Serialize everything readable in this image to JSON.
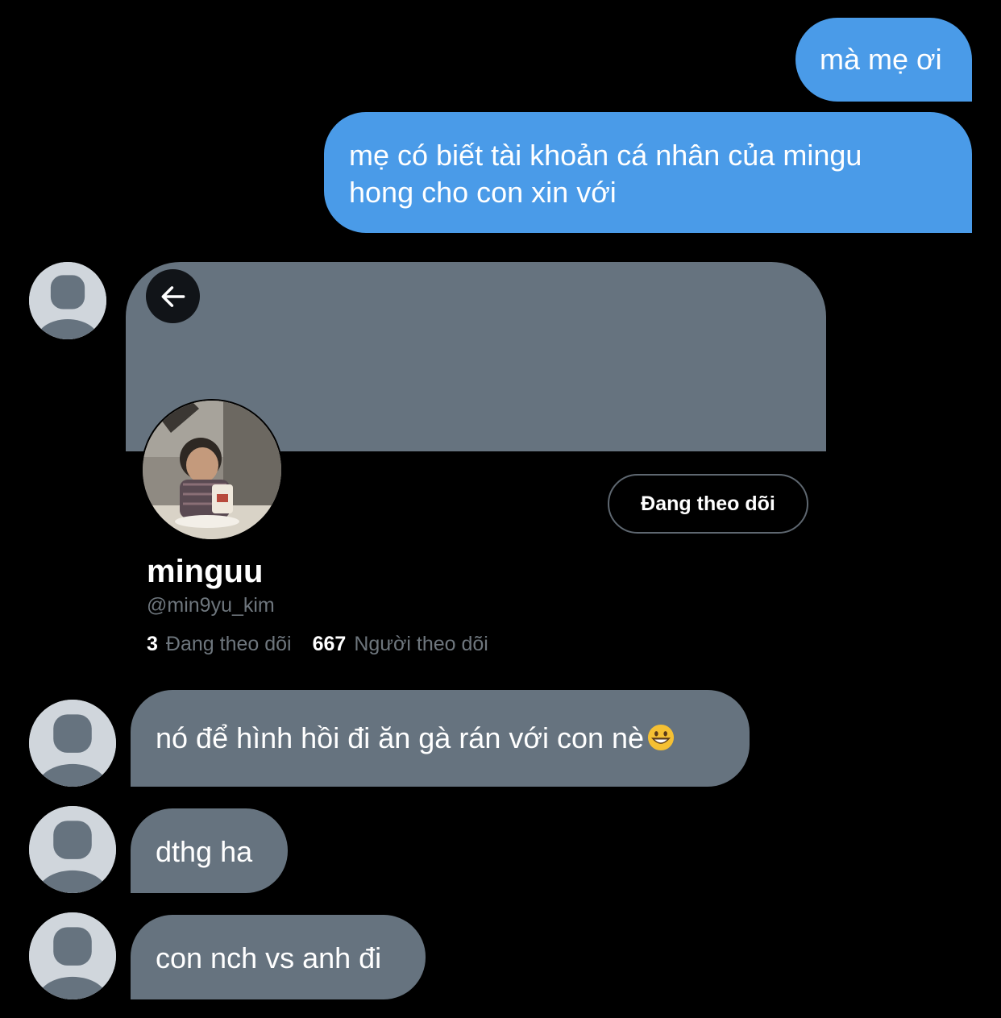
{
  "messages_sent": [
    {
      "text": "mà mẹ ơi"
    },
    {
      "line1": "mẹ có biết tài khoản cá nhân của mingu",
      "line2": "hong cho con xin với"
    }
  ],
  "shared_profile": {
    "follow_button_label": "Đang theo dõi",
    "display_name": "minguu",
    "handle": "@min9yu_kim",
    "following_count": "3",
    "following_label": "Đang theo dõi",
    "followers_count": "667",
    "followers_label": "Người theo dõi"
  },
  "messages_received": [
    {
      "text": "nó để hình hồi đi ăn gà rán với con nè",
      "emoji": "grinning-face-emoji"
    },
    {
      "text": "dthg ha"
    },
    {
      "text": "con nch vs anh đi"
    }
  ],
  "colors": {
    "background": "#000000",
    "sent_bubble": "#4a9be8",
    "received_bubble": "#66737f",
    "muted_text": "#6e767d"
  }
}
